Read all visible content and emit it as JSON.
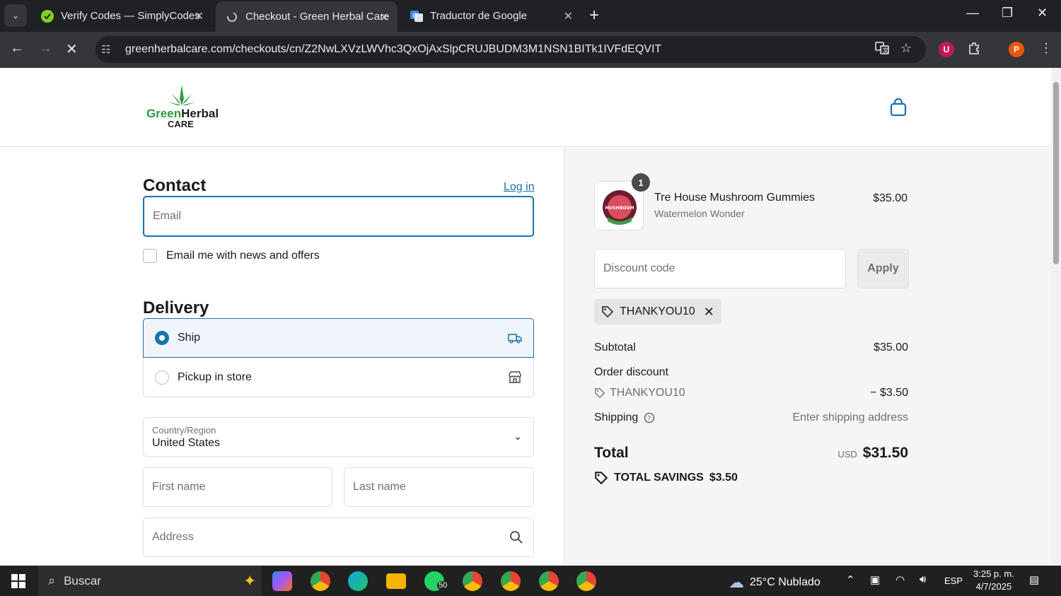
{
  "browser": {
    "tabs": [
      {
        "title": "Verify Codes — SimplyCodes",
        "active": false
      },
      {
        "title": "Checkout - Green Herbal Care",
        "active": true
      },
      {
        "title": "Traductor de Google",
        "active": false
      }
    ],
    "url": "greenherbalcare.com/checkouts/cn/Z2NwLXVzLWVhc3QxOjAxSlpCRUJBUDM3M1NSN1BITk1IVFdEQVIT",
    "profile_initial": "P",
    "ext_initial": "U"
  },
  "header": {
    "logo_line1": "GreenHerbal",
    "logo_line2": "CARE"
  },
  "contact": {
    "title": "Contact",
    "login": "Log in",
    "email_placeholder": "Email",
    "newsletter_label": "Email me with news and offers"
  },
  "delivery": {
    "title": "Delivery",
    "options": [
      {
        "label": "Ship",
        "selected": true
      },
      {
        "label": "Pickup in store",
        "selected": false
      }
    ],
    "country_label": "Country/Region",
    "country_value": "United States",
    "first_name_placeholder": "First name",
    "last_name_placeholder": "Last name",
    "address_placeholder": "Address"
  },
  "summary": {
    "item": {
      "qty": "1",
      "name": "Tre House Mushroom Gummies",
      "variant": "Watermelon Wonder",
      "price": "$35.00",
      "thumb_text": "MUSHROOM"
    },
    "discount_placeholder": "Discount code",
    "apply_label": "Apply",
    "applied_code": "THANKYOU10",
    "subtotal_label": "Subtotal",
    "subtotal_value": "$35.00",
    "order_discount_label": "Order discount",
    "order_discount_code": "THANKYOU10",
    "order_discount_value": "− $3.50",
    "shipping_label": "Shipping",
    "shipping_value": "Enter shipping address",
    "total_label": "Total",
    "currency": "USD",
    "total_value": "$31.50",
    "savings_label": "TOTAL SAVINGS",
    "savings_value": "$3.50"
  },
  "taskbar": {
    "search_label": "Buscar",
    "whatsapp_badge": "50",
    "weather": "25°C  Nublado",
    "lang": "ESP",
    "time": "3:25 p. m.",
    "date": "4/7/2025"
  },
  "colors": {
    "accent": "#1773b0",
    "chrome_dark": "#202124",
    "chrome_mid": "#35363a",
    "brand_green": "#2e9a3e"
  }
}
